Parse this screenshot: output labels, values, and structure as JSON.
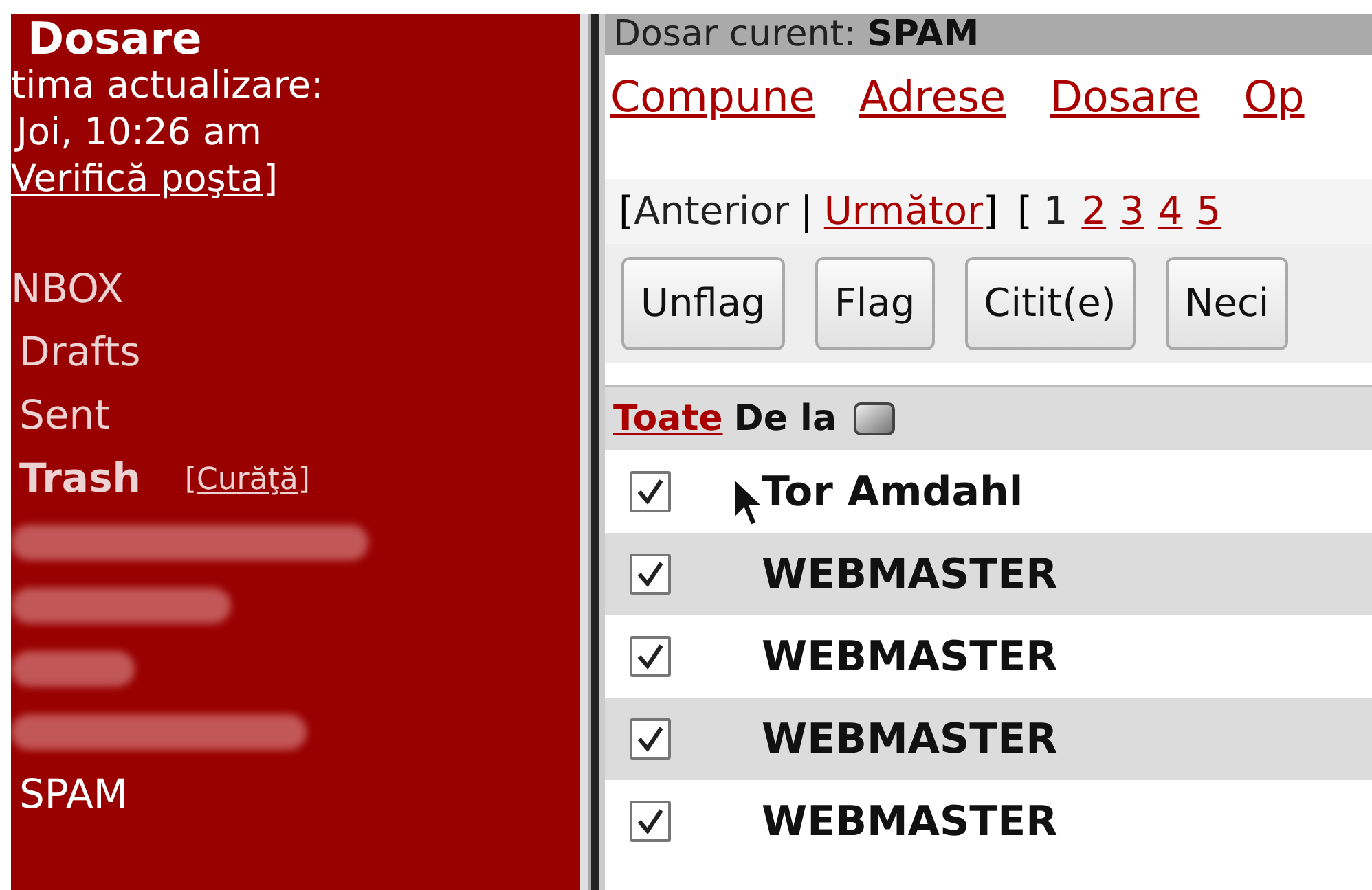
{
  "sidebar": {
    "title": "Dosare",
    "last_update_label": "tima actualizare:",
    "last_update_time": "Joi, 10:26 am",
    "check_mail_link": "Verifică poşta",
    "check_mail_close": "]",
    "folders": [
      {
        "kind": "folder",
        "label": "NBOX",
        "selected": false,
        "bold": false
      },
      {
        "kind": "folder",
        "label": "Drafts",
        "selected": false,
        "bold": false
      },
      {
        "kind": "folder",
        "label": "Sent",
        "selected": false,
        "bold": false
      },
      {
        "kind": "folder",
        "label": "Trash",
        "selected": false,
        "bold": true,
        "action_open": "[",
        "action": "Curăţă",
        "action_close": "]"
      },
      {
        "kind": "redacted"
      },
      {
        "kind": "redacted"
      },
      {
        "kind": "redacted"
      },
      {
        "kind": "redacted"
      },
      {
        "kind": "folder",
        "label": "SPAM",
        "selected": true,
        "bold": false
      }
    ]
  },
  "current_folder": {
    "label": "Dosar curent:",
    "name": "SPAM"
  },
  "menu": [
    "Compune",
    "Adrese",
    "Dosare",
    "Op"
  ],
  "pagination": {
    "open": "[",
    "prev": "Anterior",
    "prev_enabled": false,
    "separator": "|",
    "next": "Următor",
    "next_enabled": true,
    "close": "]",
    "pages_open": "[",
    "pages": [
      {
        "label": "1",
        "selected": true
      },
      {
        "label": "2",
        "selected": false
      },
      {
        "label": "3",
        "selected": false
      },
      {
        "label": "4",
        "selected": false
      },
      {
        "label": "5",
        "selected": false
      }
    ]
  },
  "buttons": [
    "Unflag",
    "Flag",
    "Citit(e)",
    "Neci"
  ],
  "table": {
    "select_all": "Toate",
    "from_header": "De la",
    "rows": [
      {
        "from": "Tor Amdahl",
        "checked": true
      },
      {
        "from": "WEBMASTER",
        "checked": true
      },
      {
        "from": "WEBMASTER",
        "checked": true
      },
      {
        "from": "WEBMASTER",
        "checked": true
      },
      {
        "from": "WEBMASTER",
        "checked": true
      }
    ]
  }
}
